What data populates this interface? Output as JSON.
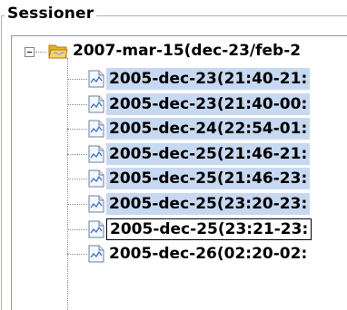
{
  "group": {
    "title": "Sessioner"
  },
  "tree": {
    "root": {
      "label": "2007-mar-15(dec-23/feb-2",
      "expanded": true,
      "icon": "folder-icon"
    },
    "items": [
      {
        "label": "2005-dec-23(21:40-21:",
        "selected": true,
        "focused": false,
        "icon": "chart-file-icon"
      },
      {
        "label": "2005-dec-23(21:40-00:",
        "selected": true,
        "focused": false,
        "icon": "chart-file-icon"
      },
      {
        "label": "2005-dec-24(22:54-01:",
        "selected": true,
        "focused": false,
        "icon": "chart-file-icon"
      },
      {
        "label": "2005-dec-25(21:46-21:",
        "selected": true,
        "focused": false,
        "icon": "chart-file-icon"
      },
      {
        "label": "2005-dec-25(21:46-23:",
        "selected": true,
        "focused": false,
        "icon": "chart-file-icon"
      },
      {
        "label": "2005-dec-25(23:20-23:",
        "selected": true,
        "focused": false,
        "icon": "chart-file-icon"
      },
      {
        "label": "2005-dec-25(23:21-23:",
        "selected": false,
        "focused": true,
        "icon": "chart-file-icon"
      },
      {
        "label": "2005-dec-26(02:20-02:",
        "selected": false,
        "focused": false,
        "icon": "chart-file-icon"
      }
    ]
  },
  "colors": {
    "selection": "#c7d8f1",
    "border": "#7f9db9",
    "folder": "#f3c44b"
  }
}
